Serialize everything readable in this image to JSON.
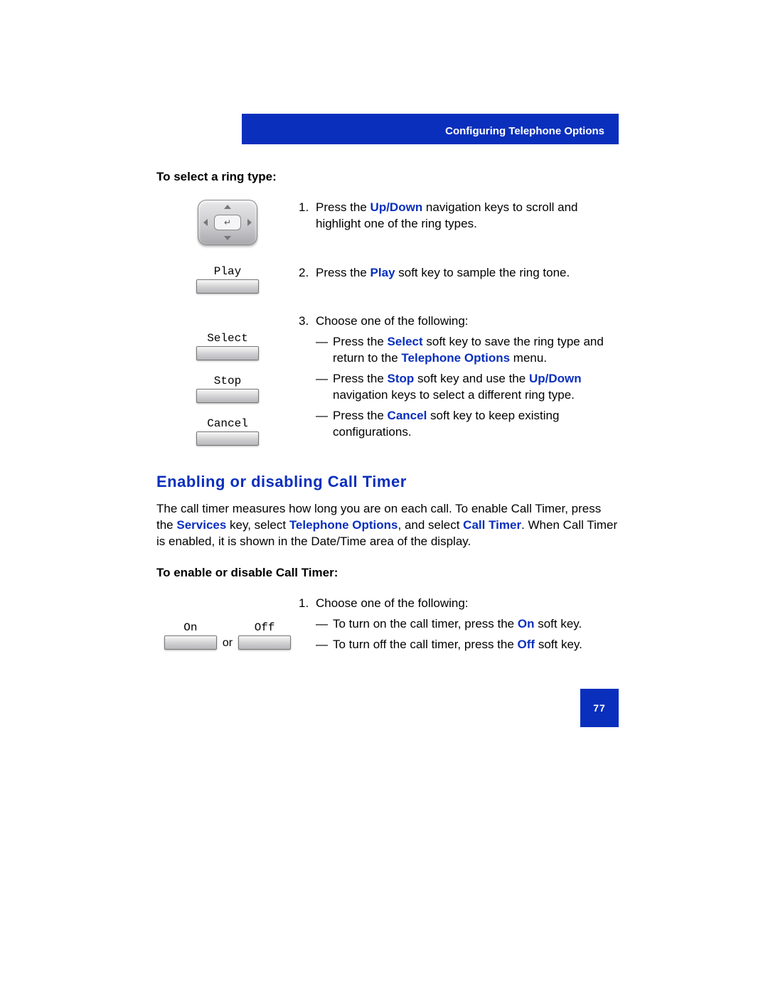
{
  "header": {
    "title": "Configuring Telephone Options"
  },
  "section1": {
    "label": "To select a ring type:",
    "step1_pre": "Press the ",
    "nav_keys": "Up/Down",
    "step1_post": " navigation keys to scroll and highlight one of the ring types.",
    "play_label": "Play",
    "step2_pre": "Press the ",
    "play_emph": "Play",
    "step2_post": " soft key to sample the ring tone.",
    "select_label": "Select",
    "stop_label": "Stop",
    "cancel_label": "Cancel",
    "step3_intro": "Choose one of the following:",
    "opt1_pre": "Press the ",
    "select_emph": "Select",
    "opt1_mid": " soft key to save the ring type and return to the ",
    "tel_opt": "Telephone Options",
    "opt1_post": " menu.",
    "opt2_pre": "Press the ",
    "stop_emph": "Stop",
    "opt2_mid": " soft key and use the ",
    "opt2_post": " navigation keys to select a different ring type.",
    "opt3_pre": "Press the ",
    "cancel_emph": "Cancel",
    "opt3_post": " soft key to keep existing configurations."
  },
  "section2": {
    "heading": "Enabling or disabling Call Timer",
    "para_a": "The call timer measures how long you are on each call. To enable Call Timer, press the ",
    "services": "Services",
    "para_b": " key, select ",
    "tel_opt": "Telephone Options",
    "para_c": ", and select ",
    "call_timer": "Call Timer",
    "para_d": ". When Call Timer is enabled, it is shown in the Date/Time area of the display.",
    "label": "To enable or disable Call Timer:",
    "on_label": "On",
    "off_label": "Off",
    "or": "or",
    "step1_intro": "Choose one of the following:",
    "opt1_pre": "To turn on the call timer, press the ",
    "on_emph": "On",
    "opt1_post": " soft key.",
    "opt2_pre": "To turn off the call timer, press the ",
    "off_emph": "Off",
    "opt2_post": " soft key."
  },
  "page_number": "77"
}
